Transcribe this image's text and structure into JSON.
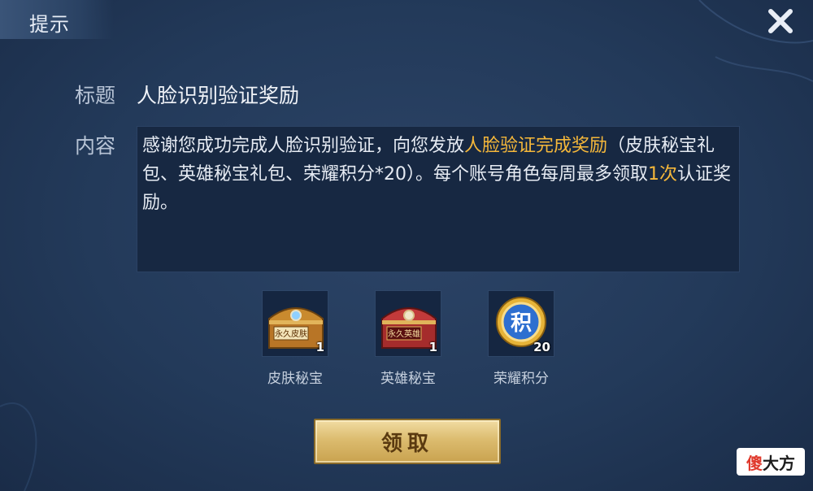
{
  "dialog": {
    "title": "提示",
    "title_label": "标题",
    "title_value": "人脸识别验证奖励",
    "content_label": "内容",
    "content_segments": [
      {
        "text": "感谢您成功完成人脸识别验证，向您发放",
        "highlight": false
      },
      {
        "text": "人脸验证完成奖励",
        "highlight": true
      },
      {
        "text": "（皮肤秘宝礼包、英雄秘宝礼包、荣耀积分*20）。每个账号角色每周最多领取",
        "highlight": false
      },
      {
        "text": "1次",
        "highlight": true
      },
      {
        "text": "认证奖励。",
        "highlight": false
      }
    ],
    "rewards": [
      {
        "name": "皮肤秘宝",
        "count": "1",
        "chest_label": "永久皮肤",
        "icon": "skin-chest-icon"
      },
      {
        "name": "英雄秘宝",
        "count": "1",
        "chest_label": "永久英雄",
        "icon": "hero-chest-icon"
      },
      {
        "name": "荣耀积分",
        "count": "20",
        "coin_label": "积",
        "icon": "honor-points-icon"
      }
    ],
    "claim_button": "领取"
  },
  "watermark": {
    "part1": "傻",
    "part2": "大方"
  },
  "colors": {
    "highlight": "#f6b83a",
    "background": "#233a5a",
    "button_gold": "#dcbc6f"
  }
}
